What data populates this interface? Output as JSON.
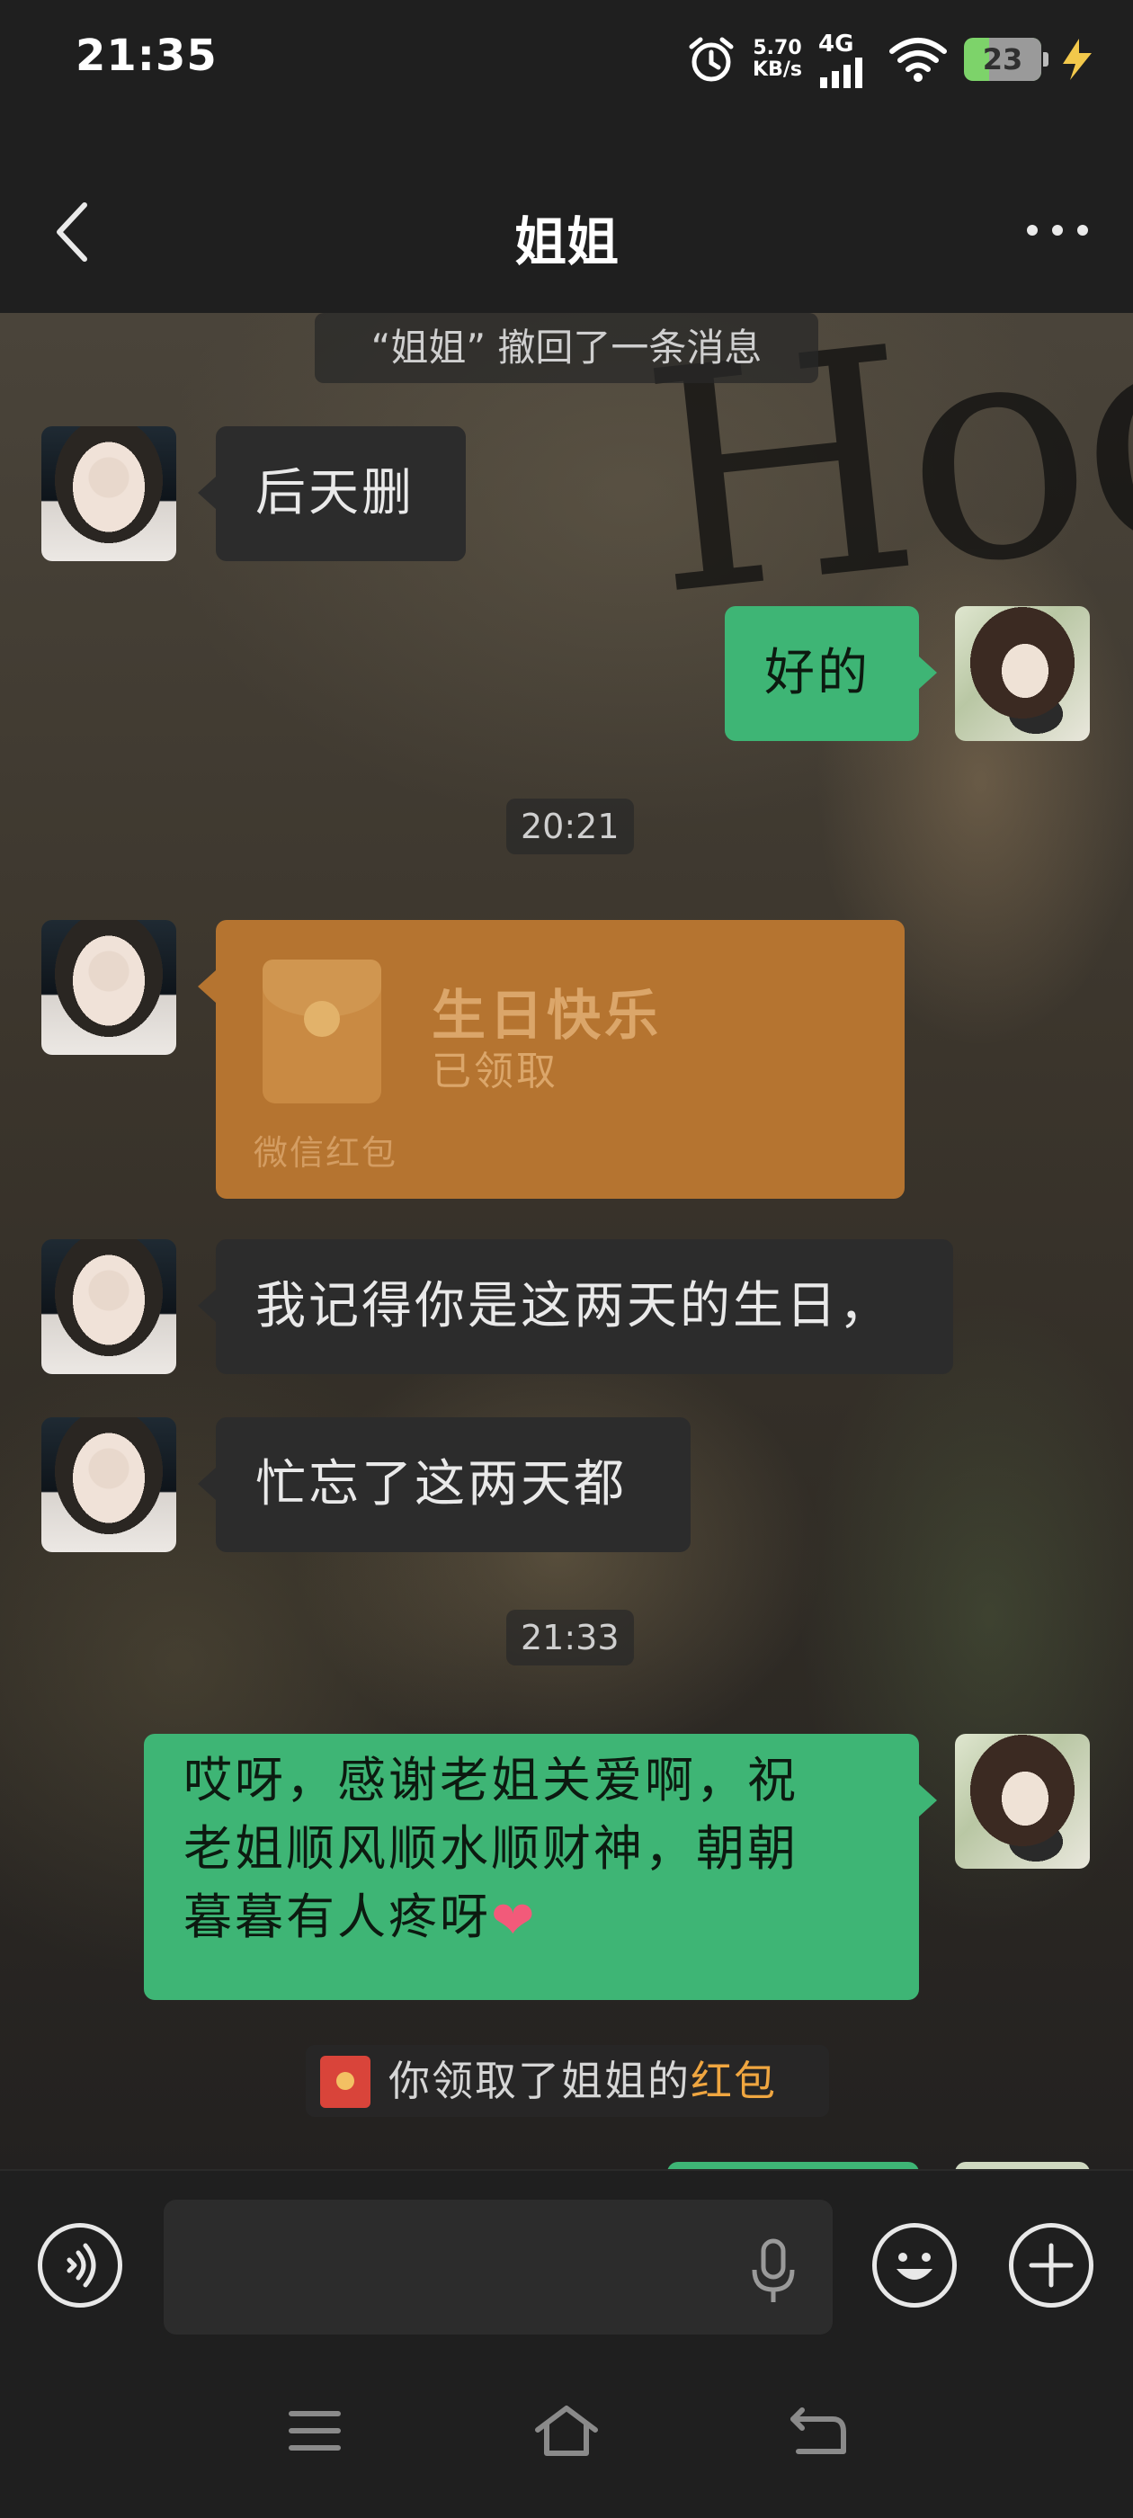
{
  "status_bar": {
    "time": "21:35",
    "net_speed_value": "5.70",
    "net_speed_unit": "KB/s",
    "network": "4G",
    "battery": "23"
  },
  "header": {
    "title": "姐姐"
  },
  "messages": {
    "recall_notice": "“姐姐” 撤回了一条消息",
    "msg1": "后天删",
    "msg2": "好的",
    "time1": "20:21",
    "red_packet": {
      "title": "生日快乐",
      "status": "已领取",
      "footer": "微信红包"
    },
    "msg3": "我记得你是这两天的生日，",
    "msg4": "忙忘了这两天都",
    "time2": "21:33",
    "msg5_line1": "哎呀，感谢老姐关爱啊，祝",
    "msg5_line2": "老姐顺风顺水顺财神，朝朝",
    "msg5_line3": "暮暮有人疼呀",
    "packet_notice_prefix": "你领取了姐姐的",
    "packet_notice_link": "红包"
  },
  "colors": {
    "sent_bubble": "#3eb575",
    "received_bubble": "#2c2c2c",
    "red_packet": "#b57430",
    "background": "#1f1f1f"
  },
  "icons": {
    "back": "chevron-left-icon",
    "more": "more-dots-icon",
    "voice": "voice-icon",
    "mic": "mic-icon",
    "emoji": "emoji-icon",
    "plus": "plus-icon"
  }
}
